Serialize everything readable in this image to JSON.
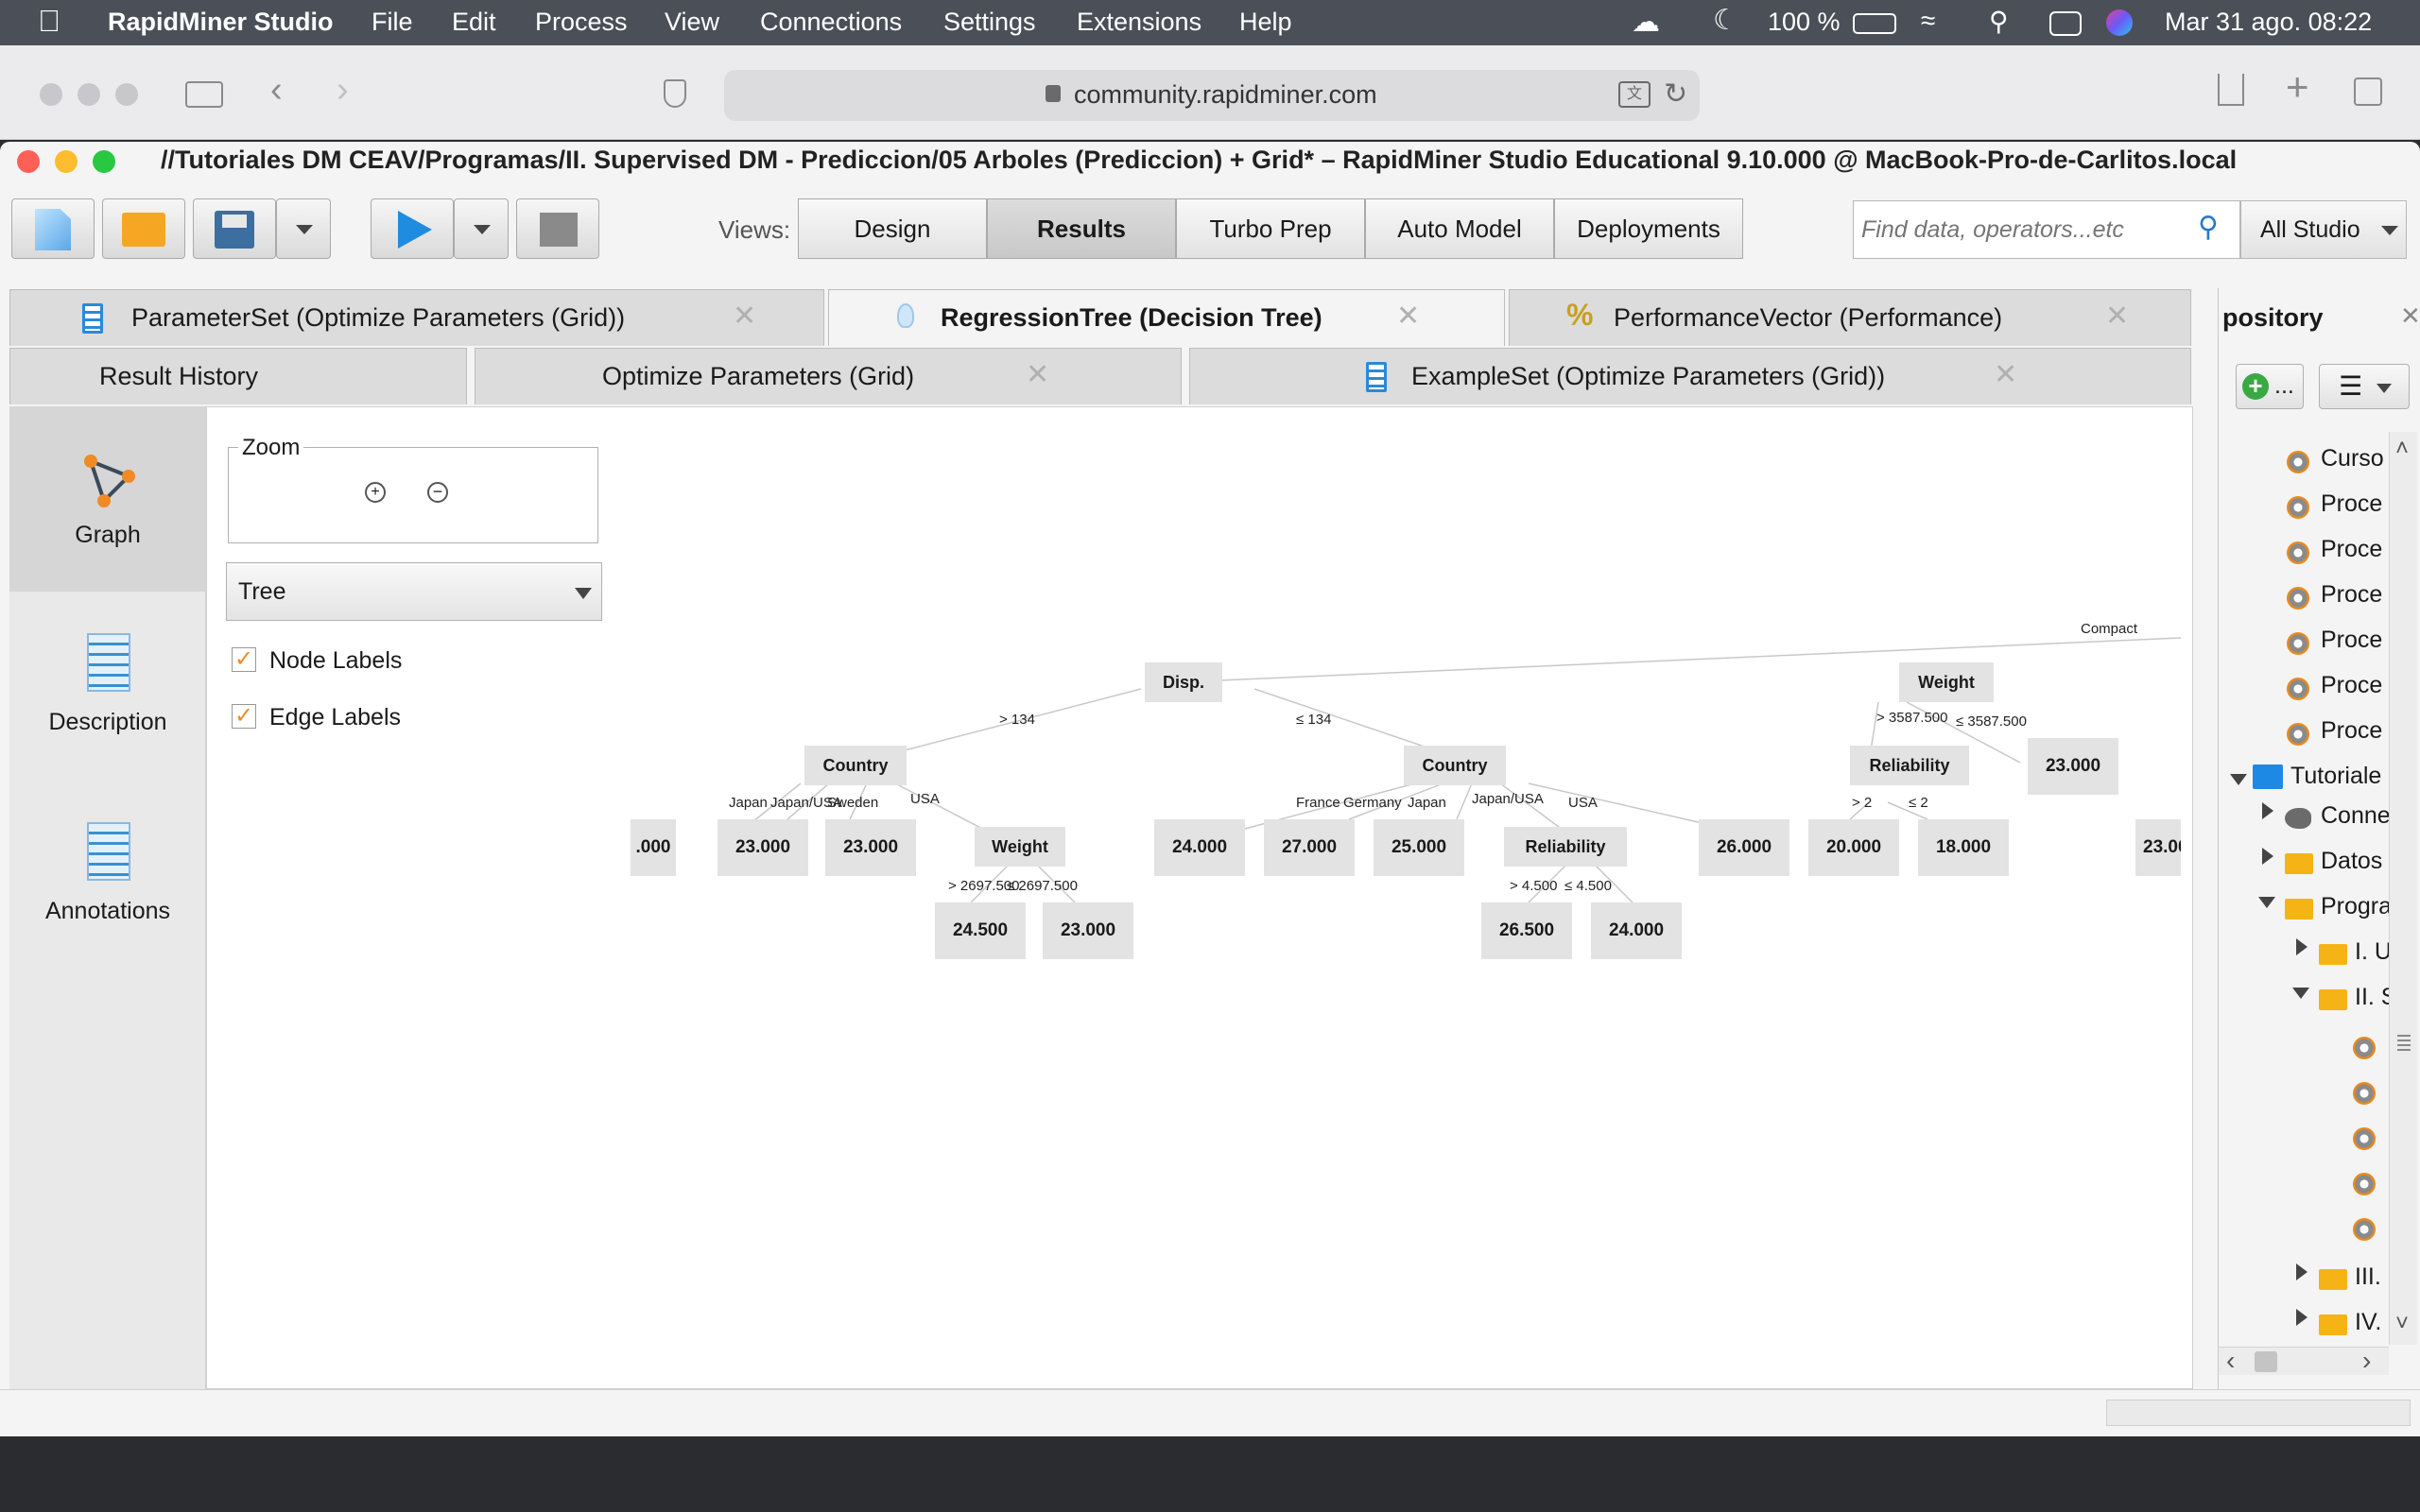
{
  "menubar": {
    "app_name": "RapidMiner Studio",
    "items": [
      "File",
      "Edit",
      "Process",
      "View",
      "Connections",
      "Settings",
      "Extensions",
      "Help"
    ],
    "battery": "100 %",
    "datetime": "Mar 31 ago.  08:22"
  },
  "browser": {
    "url": "community.rapidminer.com"
  },
  "window": {
    "title": "//Tutoriales DM CEAV/Programas/II. Supervised DM - Prediccion/05 Arboles (Prediccion) + Grid* – RapidMiner Studio Educational 9.10.000 @ MacBook-Pro-de-Carlitos.local"
  },
  "toolbar": {
    "views_label": "Views:",
    "views": [
      "Design",
      "Results",
      "Turbo Prep",
      "Auto Model",
      "Deployments"
    ],
    "active_view": "Results",
    "search_placeholder": "Find data, operators...etc",
    "scope": "All Studio"
  },
  "tabs_row1": [
    {
      "label": "ParameterSet (Optimize Parameters (Grid))",
      "icon": "parameter-set-icon"
    },
    {
      "label": "RegressionTree (Decision Tree)",
      "icon": "lightbulb-icon",
      "active": true
    },
    {
      "label": "PerformanceVector (Performance)",
      "icon": "percent-icon"
    }
  ],
  "tabs_row2": [
    {
      "label": "Result History"
    },
    {
      "label": "Optimize Parameters (Grid)"
    },
    {
      "label": "ExampleSet (Optimize Parameters (Grid))",
      "icon": "example-set-icon"
    }
  ],
  "side_views": [
    "Graph",
    "Description",
    "Annotations"
  ],
  "graph_controls": {
    "zoom_label": "Zoom",
    "layout": "Tree",
    "node_labels": "Node Labels",
    "edge_labels": "Edge Labels"
  },
  "tree": {
    "nodes": {
      "root": "Disp.",
      "country_left": "Country",
      "weight_left": "Weight",
      "country_right": "Country",
      "reliability_mid": "Reliability",
      "weight_right": "Weight",
      "reliability_right": "Reliability"
    },
    "edges": {
      "gt134": "> 134",
      "le134": "≤ 134",
      "japan": "Japan",
      "japan_usa": "Japan/USA",
      "sweden": "Sweden",
      "usa": "USA",
      "gt2697": "> 2697.500",
      "le2697": "≤ 2697.500",
      "france": "France",
      "germany": "Germany",
      "japan2": "Japan",
      "japan_usa2": "Japan/USA",
      "usa2": "USA",
      "gt4500": "> 4.500",
      "le4500": "≤ 4.500",
      "compact": "Compact",
      "gt3587": "> 3587.500",
      "le3587": "≤ 3587.500",
      "gt2": "> 2",
      "le2": "≤ 2"
    },
    "leaves": {
      "l0": ".000",
      "l1": "23.000",
      "l2": "23.000",
      "l3": "24.500",
      "l4": "23.000",
      "l5": "24.000",
      "l6": "27.000",
      "l7": "25.000",
      "l8": "26.500",
      "l9": "24.000",
      "l10": "26.000",
      "l11": "20.000",
      "l12": "18.000",
      "l13": "23.000",
      "l14": "23.00"
    }
  },
  "repository": {
    "title": "pository",
    "add_label": "...",
    "items": [
      "Curso",
      "Proce",
      "Proce",
      "Proce",
      "Proce",
      "Proce",
      "Proce"
    ],
    "root": "Tutoriale",
    "children": [
      "Conne",
      "Datos",
      "Progra",
      "I. U",
      "II. S",
      "III.",
      "IV."
    ]
  }
}
